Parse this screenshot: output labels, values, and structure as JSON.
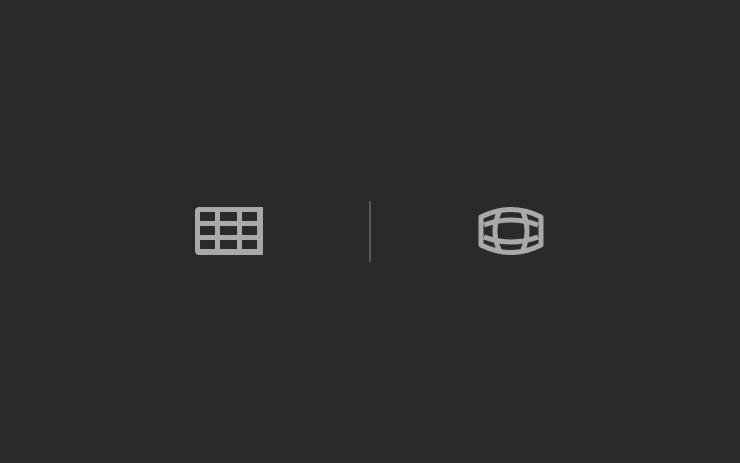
{
  "view_toggle": {
    "buttons": [
      {
        "id": "flat",
        "icon": "grid-icon"
      },
      {
        "id": "sphere",
        "icon": "sphere-icon"
      }
    ]
  },
  "colors": {
    "background": "#2a2a2b",
    "icon": "#a9a9a9",
    "divider": "#5a5a5b"
  }
}
